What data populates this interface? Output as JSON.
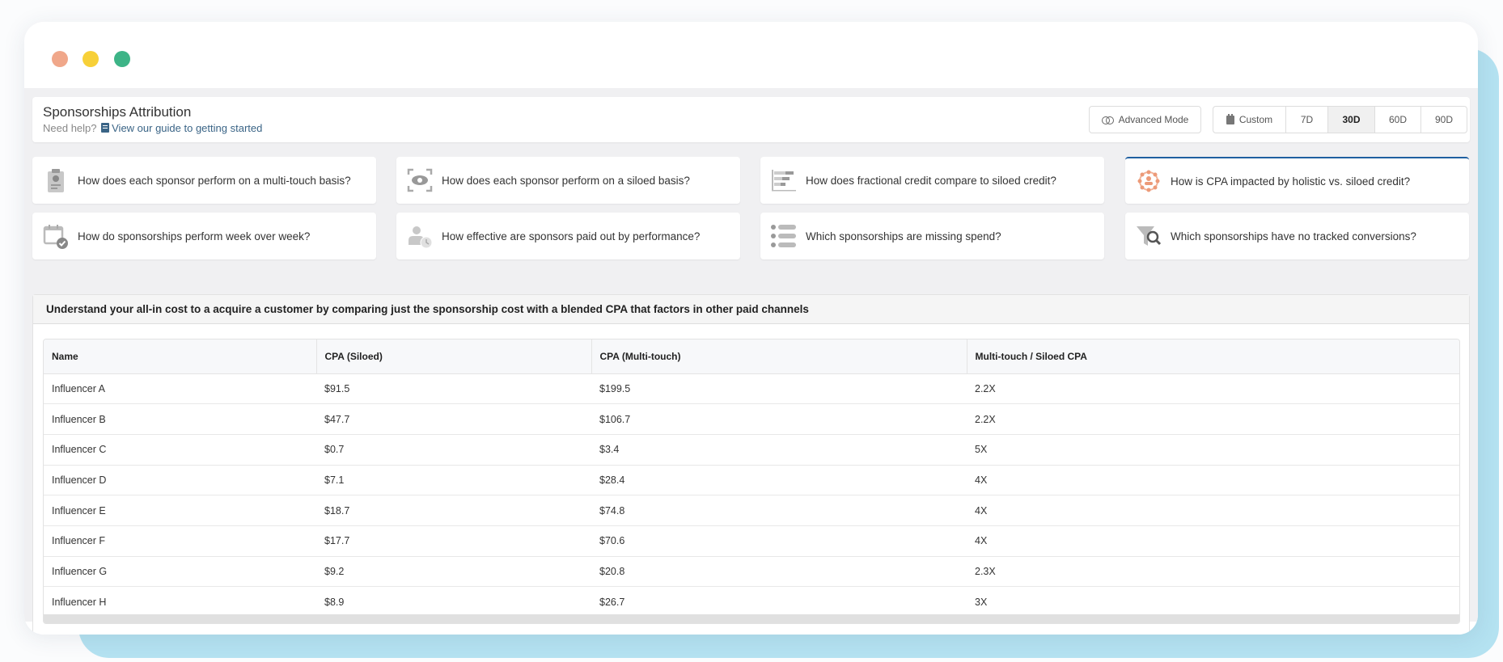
{
  "window": {
    "controls": [
      "close",
      "minimize",
      "maximize"
    ]
  },
  "header": {
    "title": "Sponsorships Attribution",
    "help_prefix": "Need help?",
    "help_icon": "book-icon",
    "help_link": "View our guide to getting started",
    "advanced_mode_label": "Advanced Mode",
    "advanced_mode_icon": "toggle-icon",
    "date_range": {
      "options": [
        {
          "label": "Custom",
          "icon": "calendar-icon"
        },
        {
          "label": "7D"
        },
        {
          "label": "30D"
        },
        {
          "label": "60D"
        },
        {
          "label": "90D"
        }
      ],
      "selected": "30D"
    }
  },
  "questions": [
    {
      "label": "How does each sponsor perform on a multi-touch basis?",
      "icon": "clipboard-chart-icon",
      "active": false
    },
    {
      "label": "How does each sponsor perform on a siloed basis?",
      "icon": "eye-scan-icon",
      "active": false
    },
    {
      "label": "How does fractional credit compare to siloed credit?",
      "icon": "bar-chart-icon",
      "active": false
    },
    {
      "label": "How is CPA impacted by holistic vs. siloed credit?",
      "icon": "network-user-icon",
      "active": true
    },
    {
      "label": "How do sponsorships perform week over week?",
      "icon": "calendar-check-icon",
      "active": false
    },
    {
      "label": "How effective are sponsors paid out by performance?",
      "icon": "user-clock-icon",
      "active": false
    },
    {
      "label": "Which sponsorships are missing spend?",
      "icon": "list-icon",
      "active": false
    },
    {
      "label": "Which sponsorships have no tracked conversions?",
      "icon": "funnel-search-icon",
      "active": false
    }
  ],
  "accent_color": "#1f5fa0",
  "panel": {
    "description": "Understand your all-in cost to a acquire a customer by comparing just the sponsorship cost with a blended CPA that factors in other paid channels",
    "table": {
      "columns": [
        "Name",
        "CPA (Siloed)",
        "CPA (Multi-touch)",
        "Multi-touch / Siloed CPA"
      ],
      "rows": [
        [
          "Influencer A",
          "$91.5",
          "$199.5",
          "2.2X"
        ],
        [
          "Influencer B",
          "$47.7",
          "$106.7",
          "2.2X"
        ],
        [
          "Influencer C",
          "$0.7",
          "$3.4",
          "5X"
        ],
        [
          "Influencer D",
          "$7.1",
          "$28.4",
          "4X"
        ],
        [
          "Influencer E",
          "$18.7",
          "$74.8",
          "4X"
        ],
        [
          "Influencer F",
          "$17.7",
          "$70.6",
          "4X"
        ],
        [
          "Influencer G",
          "$9.2",
          "$20.8",
          "2.3X"
        ],
        [
          "Influencer H",
          "$8.9",
          "$26.7",
          "3X"
        ]
      ]
    }
  }
}
